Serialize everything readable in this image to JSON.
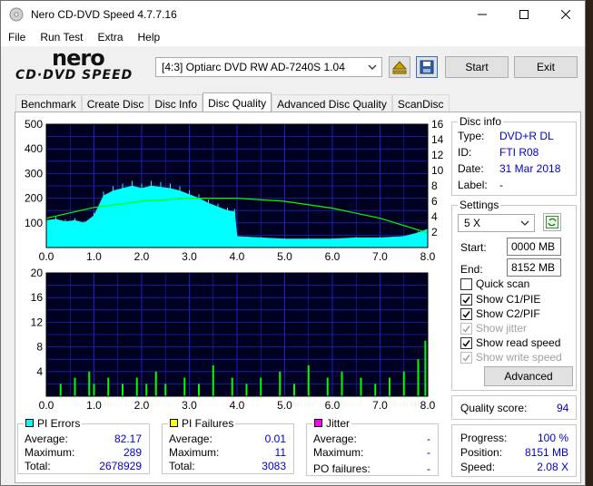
{
  "window": {
    "title": "Nero CD-DVD Speed 4.7.7.16",
    "controls": [
      "minimize",
      "maximize",
      "close"
    ]
  },
  "menu": [
    "File",
    "Run Test",
    "Extra",
    "Help"
  ],
  "logo_text": [
    "nero",
    "CD·DVD SPEED"
  ],
  "toolbar": {
    "drive": "[4:3]  Optiarc DVD RW AD-7240S 1.04",
    "start_label": "Start",
    "exit_label": "Exit"
  },
  "tabs": [
    {
      "label": "Benchmark",
      "active": false
    },
    {
      "label": "Create Disc",
      "active": false
    },
    {
      "label": "Disc Info",
      "active": false
    },
    {
      "label": "Disc Quality",
      "active": true
    },
    {
      "label": "Advanced Disc Quality",
      "active": false
    },
    {
      "label": "ScanDisc",
      "active": false
    }
  ],
  "disc_info": {
    "title": "Disc info",
    "type_label": "Type:",
    "type_value": "DVD+R DL",
    "id_label": "ID:",
    "id_value": "FTI R08",
    "date_label": "Date:",
    "date_value": "31 Mar 2018",
    "label_label": "Label:",
    "label_value": "-"
  },
  "settings": {
    "title": "Settings",
    "speed": "5 X",
    "start_label": "Start:",
    "start_value": "0000 MB",
    "end_label": "End:",
    "end_value": "8152 MB",
    "checks": [
      {
        "label": "Quick scan",
        "checked": false,
        "disabled": false
      },
      {
        "label": "Show C1/PIE",
        "checked": true,
        "disabled": false
      },
      {
        "label": "Show C2/PIF",
        "checked": true,
        "disabled": false
      },
      {
        "label": "Show jitter",
        "checked": true,
        "disabled": true
      },
      {
        "label": "Show read speed",
        "checked": true,
        "disabled": false
      },
      {
        "label": "Show write speed",
        "checked": true,
        "disabled": true
      }
    ],
    "advanced_label": "Advanced"
  },
  "quality": {
    "label": "Quality score:",
    "value": "94"
  },
  "progress": {
    "progress_label": "Progress:",
    "progress_value": "100 %",
    "position_label": "Position:",
    "position_value": "8151 MB",
    "speed_label": "Speed:",
    "speed_value": "2.08 X"
  },
  "pi_errors": {
    "title": "PI Errors",
    "color": "#00ffff",
    "average_label": "Average:",
    "average": "82.17",
    "maximum_label": "Maximum:",
    "maximum": "289",
    "total_label": "Total:",
    "total": "2678929"
  },
  "pi_failures": {
    "title": "PI Failures",
    "color": "#ffff00",
    "average_label": "Average:",
    "average": "0.01",
    "maximum_label": "Maximum:",
    "maximum": "11",
    "total_label": "Total:",
    "total": "3083"
  },
  "jitter": {
    "title": "Jitter",
    "color": "#ff00ff",
    "average_label": "Average:",
    "average": "-",
    "maximum_label": "Maximum:",
    "maximum": "-",
    "po_label": "PO failures:",
    "po_value": "-"
  },
  "chart_data": [
    {
      "type": "area",
      "name": "PI Errors",
      "x_ticks": [
        "0.0",
        "1.0",
        "2.0",
        "3.0",
        "4.0",
        "5.0",
        "6.0",
        "7.0",
        "8.0"
      ],
      "y_ticks_left": [
        "100",
        "200",
        "300",
        "400",
        "500"
      ],
      "y_ticks_right": [
        "2",
        "4",
        "6",
        "8",
        "10",
        "12",
        "14",
        "16"
      ],
      "xlim": [
        0,
        8
      ],
      "ylim": [
        0,
        500
      ],
      "y2lim": [
        0,
        16
      ],
      "series": [
        {
          "color": "#00ffff",
          "x": [
            0,
            0.2,
            0.4,
            0.6,
            0.8,
            1.0,
            1.2,
            1.4,
            1.6,
            1.8,
            2.0,
            2.2,
            2.4,
            2.6,
            2.8,
            3.0,
            3.2,
            3.4,
            3.6,
            3.8,
            3.95,
            4.0,
            4.5,
            5.0,
            5.5,
            6.0,
            6.5,
            7.0,
            7.5,
            7.8,
            8.0
          ],
          "y": [
            110,
            115,
            105,
            110,
            100,
            130,
            210,
            230,
            240,
            250,
            240,
            250,
            245,
            240,
            230,
            215,
            200,
            180,
            165,
            150,
            145,
            45,
            40,
            35,
            35,
            35,
            40,
            40,
            45,
            60,
            75
          ]
        },
        {
          "color": "#00ff00",
          "x": [
            0,
            1,
            2,
            3,
            4,
            5,
            6,
            7,
            8
          ],
          "y2": [
            3.8,
            5.2,
            6.0,
            6.4,
            6.4,
            6.0,
            5.1,
            3.8,
            1.9
          ]
        }
      ]
    },
    {
      "type": "bar",
      "name": "PI Failures",
      "x_ticks": [
        "0.0",
        "1.0",
        "2.0",
        "3.0",
        "4.0",
        "5.0",
        "6.0",
        "7.0",
        "8.0"
      ],
      "y_ticks": [
        "4",
        "8",
        "12",
        "16",
        "20"
      ],
      "xlim": [
        0,
        8
      ],
      "ylim": [
        0,
        20
      ],
      "series": [
        {
          "color": "#00ff00",
          "x": [
            0.3,
            0.6,
            0.9,
            1.0,
            1.3,
            1.6,
            1.9,
            2.1,
            2.3,
            2.5,
            2.9,
            3.2,
            3.5,
            3.9,
            4.2,
            4.5,
            4.9,
            5.2,
            5.5,
            5.9,
            6.2,
            6.6,
            6.9,
            7.2,
            7.5,
            7.8,
            7.95
          ],
          "y": [
            2,
            3,
            4,
            2,
            3,
            2,
            3,
            2,
            4,
            2,
            3,
            2,
            5,
            3,
            2,
            3,
            4,
            2,
            5,
            3,
            4,
            3,
            2,
            3,
            4,
            6,
            9
          ]
        }
      ]
    }
  ]
}
